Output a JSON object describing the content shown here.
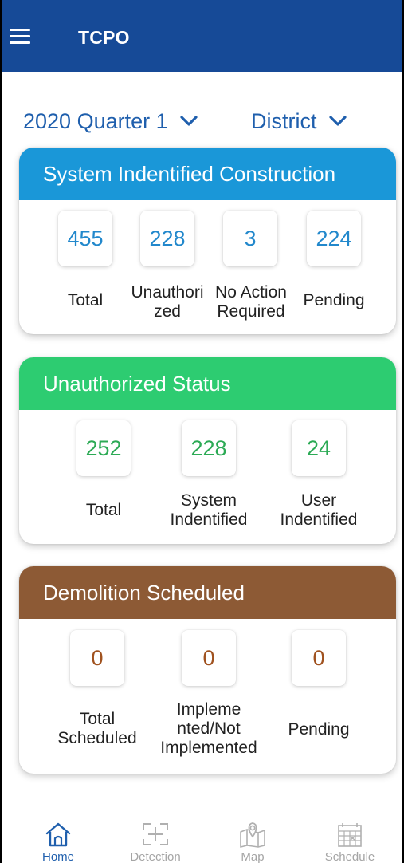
{
  "app": {
    "title": "TCPO"
  },
  "filters": {
    "quarter": "2020 Quarter 1",
    "district": "District"
  },
  "cards": [
    {
      "title": "System Indentified Construction",
      "color": "#1a97d8",
      "stats": [
        {
          "value": "455",
          "label": "Total"
        },
        {
          "value": "228",
          "label": "Unauthori\nzed"
        },
        {
          "value": "3",
          "label": "No Action\nRequired"
        },
        {
          "value": "224",
          "label": "Pending"
        }
      ]
    },
    {
      "title": "Unauthorized Status",
      "color": "#2dcc71",
      "stats": [
        {
          "value": "252",
          "label": "Total"
        },
        {
          "value": "228",
          "label": "System\nIndentified"
        },
        {
          "value": "24",
          "label": "User\nIndentified"
        }
      ]
    },
    {
      "title": "Demolition Scheduled",
      "color": "#8d5a35",
      "stats": [
        {
          "value": "0",
          "label": "Total\nScheduled"
        },
        {
          "value": "0",
          "label": "Impleme\nnted/Not\nImplemented"
        },
        {
          "value": "0",
          "label": "Pending"
        }
      ]
    }
  ],
  "nav": [
    {
      "label": "Home",
      "icon": "home-icon",
      "active": true
    },
    {
      "label": "Detection",
      "icon": "detection-icon",
      "active": false
    },
    {
      "label": "Map",
      "icon": "map-icon",
      "active": false
    },
    {
      "label": "Schedule",
      "icon": "schedule-icon",
      "active": false
    }
  ]
}
